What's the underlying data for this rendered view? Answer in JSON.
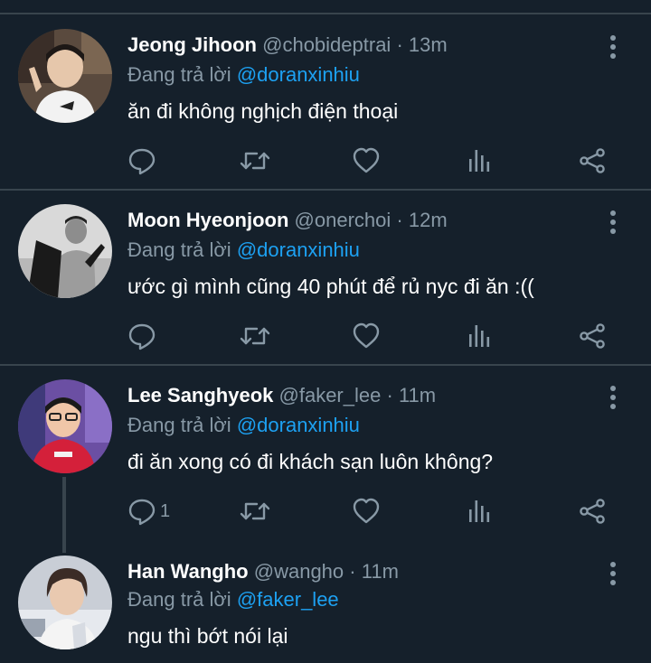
{
  "colors": {
    "background": "#15202b",
    "divider": "#38444d",
    "secondary_text": "#8899a6",
    "mention": "#1da1f2",
    "primary_text": "#ffffff"
  },
  "icons": {
    "reply": "comment-bubble-icon",
    "retweet": "retweet-icon",
    "like": "heart-icon",
    "stats": "bar-chart-icon",
    "share": "share-icon",
    "more": "vertical-dots-icon"
  },
  "tweets": [
    {
      "display_name": "Jeong Jihoon",
      "handle": "@chobideptrai",
      "separator": "·",
      "time": "13m",
      "reply_prefix": "Đang trả lời",
      "reply_to": "@doranxinhiu",
      "text": "ăn đi không nghịch điện thoại",
      "reply_count": ""
    },
    {
      "display_name": "Moon Hyeonjoon",
      "handle": "@onerchoi",
      "separator": "·",
      "time": "12m",
      "reply_prefix": "Đang trả lời",
      "reply_to": "@doranxinhiu",
      "text": "ước gì mình cũng 40 phút để rủ nyc đi ăn :((",
      "reply_count": ""
    },
    {
      "display_name": "Lee Sanghyeok",
      "handle": "@faker_lee",
      "separator": "·",
      "time": "11m",
      "reply_prefix": "Đang trả lời",
      "reply_to": "@doranxinhiu",
      "text": "đi ăn xong có đi khách sạn luôn không?",
      "reply_count": "1"
    },
    {
      "display_name": "Han Wangho",
      "handle": "@wangho",
      "separator": "·",
      "time": "11m",
      "reply_prefix": "Đang trả lời",
      "reply_to": "@faker_lee",
      "text": "ngu thì bớt nói lại",
      "reply_count": ""
    }
  ]
}
